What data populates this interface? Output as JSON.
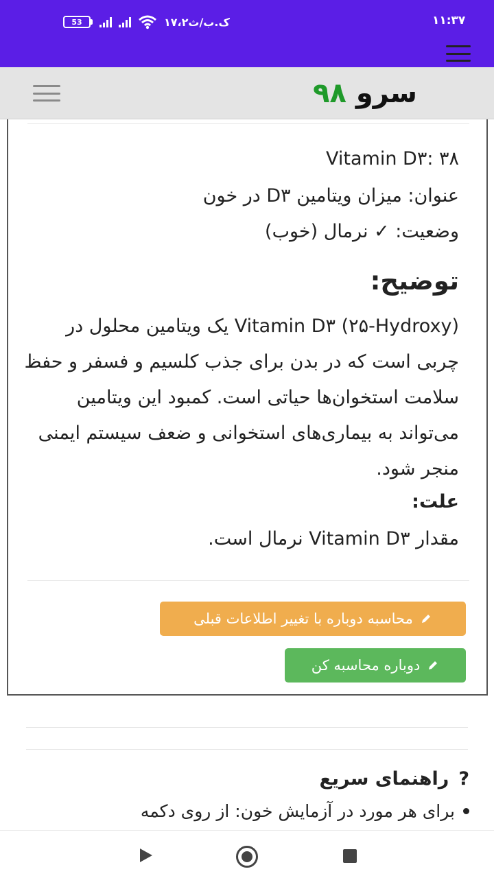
{
  "status_bar": {
    "time": "۱۱:۳۷",
    "net_speed": "۱۷،۲ک.ب/ث",
    "battery": "53"
  },
  "header": {
    "logo_word": "سرو",
    "logo_number": "۹۸"
  },
  "result": {
    "value_line": "Vitamin D۳: ۳۸",
    "title_line": "عنوان: میزان ویتامین D۳ در خون",
    "status_line": "وضعیت: ✓ نرمال (خوب)",
    "description_heading": "توضیح:",
    "description_body": "Vitamin D۳ (۲۵-Hydroxy) یک ویتامین محلول در چربی است که در بدن برای جذب کلسیم و فسفر و حفظ سلامت استخوان‌ها حیاتی است. کمبود این ویتامین می‌تواند به بیماری‌های استخوانی و ضعف سیستم ایمنی منجر شود.",
    "cause_heading": "علت:",
    "cause_body": "مقدار Vitamin D۳ نرمال است."
  },
  "buttons": {
    "recalculate_with_change": "محاسبه دوباره با تغییر اطلاعات قبلی",
    "recalculate": "دوباره محاسبه کن"
  },
  "guide": {
    "title": "راهنمای سریع",
    "question_icon": "?",
    "item_1": "برای هر مورد در آزمایش خون: از روی دکمه"
  },
  "colors": {
    "purple": "#5b1ee6",
    "logo_green": "#1f9a2a",
    "orange_button": "#f0ad4e",
    "green_button": "#5cb85c"
  },
  "icons": [
    "battery-icon",
    "signal-icon",
    "wifi-icon",
    "menu-icon",
    "pencil-icon",
    "question-icon",
    "back-icon",
    "home-icon",
    "recent-apps-icon"
  ]
}
